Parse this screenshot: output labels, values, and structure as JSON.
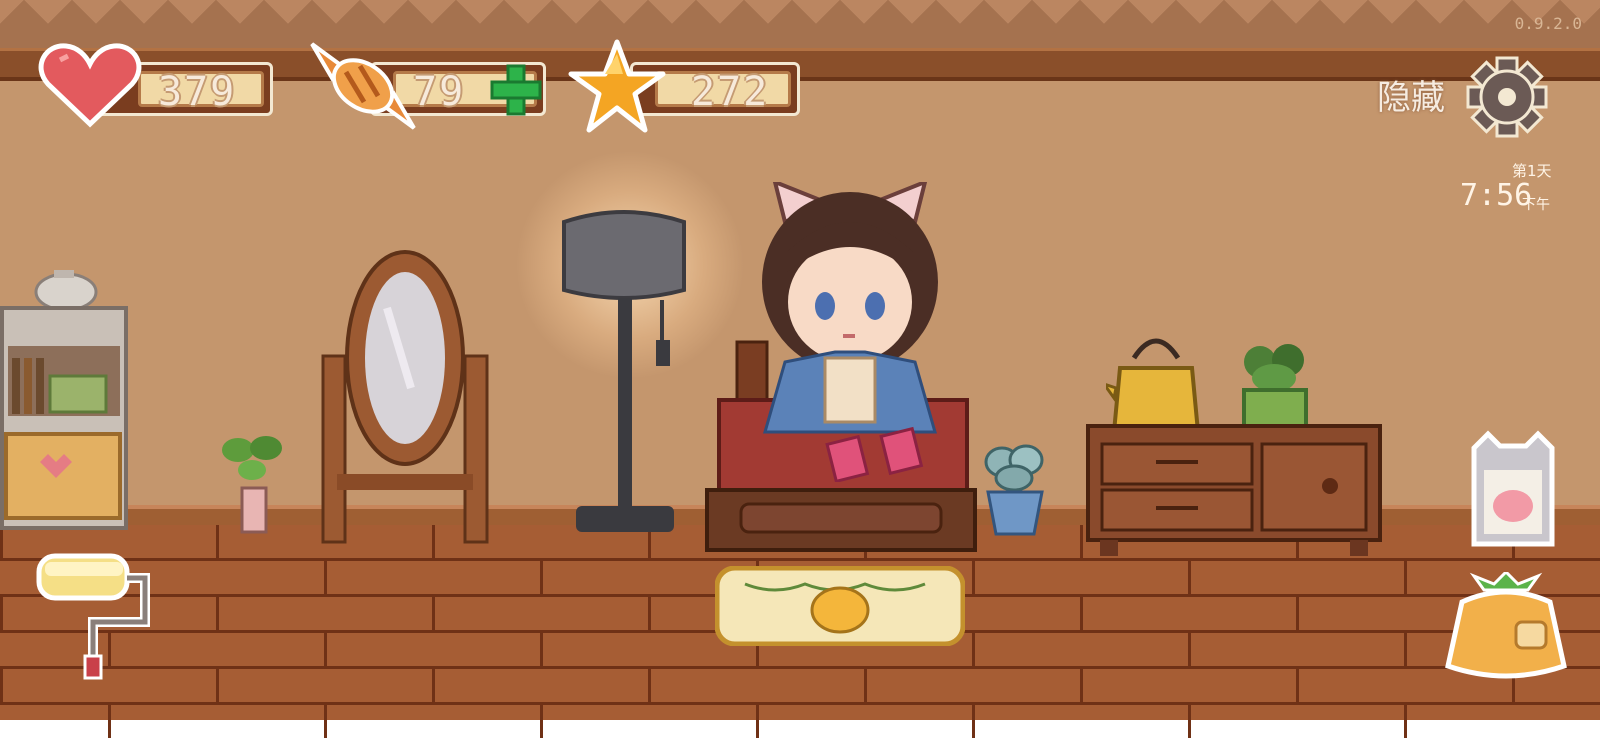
{
  "version": "0.9.2.0",
  "hud": {
    "hearts": {
      "icon": "heart-icon",
      "value": "379"
    },
    "candy": {
      "icon": "candy-icon",
      "value": "79",
      "add_icon": "plus-icon"
    },
    "stars": {
      "icon": "star-icon",
      "value": "272"
    }
  },
  "top_right": {
    "hide_label": "隐藏",
    "settings_icon": "gear-icon",
    "day_label": "第1天",
    "time": "7:56",
    "ampm": "下午"
  },
  "tools": {
    "left": "paint-roller-icon",
    "right_top": "cat-card-icon",
    "right_bottom": "backpack-icon"
  },
  "colors": {
    "wall": "#c4966d",
    "floor": "#a65d34",
    "heart": "#e35a5e",
    "star": "#f4a523",
    "plus": "#2db34a"
  }
}
